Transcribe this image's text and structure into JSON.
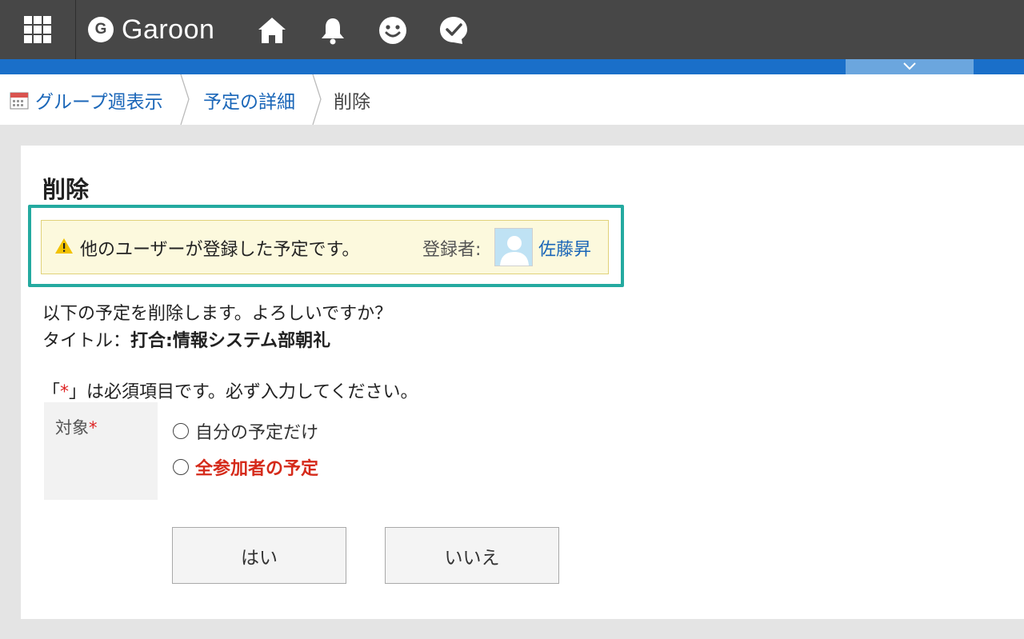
{
  "header": {
    "logo_mark": "G",
    "logo_text": "Garoon",
    "icons": [
      "apps-grid-icon",
      "home-icon",
      "bell-icon",
      "smile-icon",
      "checked-bubble-icon"
    ]
  },
  "breadcrumb": {
    "items": [
      {
        "label": "グループ週表示",
        "icon": "calendar-icon"
      },
      {
        "label": "予定の詳細"
      },
      {
        "label": "削除"
      }
    ]
  },
  "page": {
    "title": "削除",
    "notice": {
      "message": "他のユーザーが登録した予定です。",
      "registrant_label": "登録者:",
      "registrant_name": "佐藤昇"
    },
    "confirm_line": "以下の予定を削除します。よろしいですか？",
    "title_label": "タイトル：",
    "title_value": "打合:情報システム部朝礼",
    "required_note": {
      "open": "「",
      "asterisk": "*",
      "rest": "」は必須項目です。必ず入力してください。"
    },
    "target_field": {
      "label": "対象",
      "asterisk": "*",
      "options": [
        "自分の予定だけ",
        "全参加者の予定"
      ]
    },
    "buttons": {
      "yes": "はい",
      "no": "いいえ"
    }
  },
  "colors": {
    "header_bg": "#474747",
    "accent_blue": "#1a6fc9",
    "link": "#1a66b8",
    "highlight_border": "#24aaa0",
    "notice_bg": "#fcf9dd",
    "danger": "#d52a1a"
  }
}
